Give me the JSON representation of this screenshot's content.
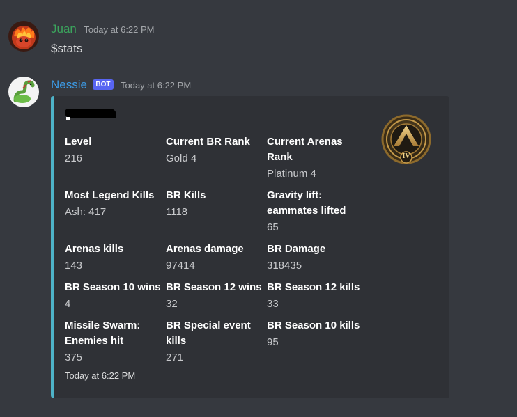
{
  "messages": [
    {
      "username": "Juan",
      "username_color": "#3ba55d",
      "timestamp": "Today at 6:22 PM",
      "content": "$stats"
    },
    {
      "username": "Nessie",
      "username_color": "#3c9be6",
      "bot_tag": "BOT",
      "timestamp": "Today at 6:22 PM",
      "embed": {
        "accent_color": "#4eb3c8",
        "thumbnail": {
          "icon": "apex-rank-badge-icon",
          "label": "IV"
        },
        "fields": [
          {
            "name": "Level",
            "value": "216"
          },
          {
            "name": "Current BR Rank",
            "value": "Gold 4"
          },
          {
            "name": "Current Arenas Rank",
            "value": "Platinum 4"
          },
          {
            "name": "Most Legend Kills",
            "value": "Ash: 417"
          },
          {
            "name": "BR Kills",
            "value": "1118"
          },
          {
            "name": "Gravity lift: eammates lifted",
            "value": "65"
          },
          {
            "name": "Arenas kills",
            "value": "143"
          },
          {
            "name": "Arenas damage",
            "value": "97414"
          },
          {
            "name": "BR Damage",
            "value": "318435"
          },
          {
            "name": "BR Season 10 wins",
            "value": "4"
          },
          {
            "name": "BR Season 12 wins",
            "value": "32"
          },
          {
            "name": "BR Season 12 kills",
            "value": "33"
          },
          {
            "name": "Missile Swarm: Enemies hit",
            "value": "375"
          },
          {
            "name": "BR Special event kills",
            "value": "271"
          },
          {
            "name": "BR Season 10 kills",
            "value": "95"
          }
        ],
        "footer": "Today at 6:22 PM"
      }
    }
  ]
}
